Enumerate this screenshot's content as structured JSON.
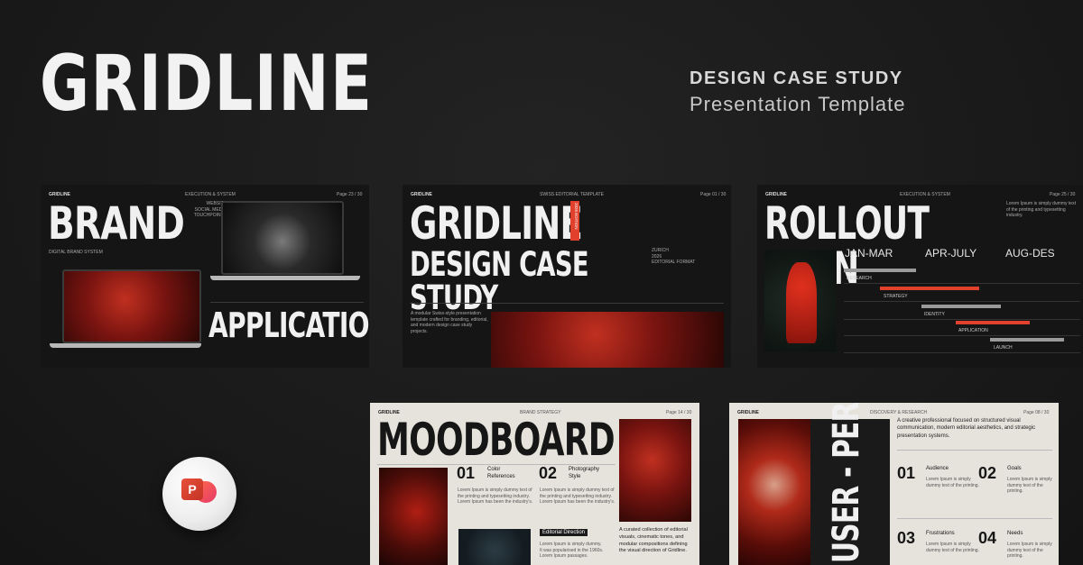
{
  "header": {
    "title": "GRIDLINE",
    "tagline_line1": "DESIGN CASE STUDY",
    "tagline_line2": "Presentation Template"
  },
  "slide1": {
    "logo": "GRIDLINE",
    "section": "EXECUTION & SYSTEM",
    "page": "Page 23 / 30",
    "title": "BRAND",
    "subtitle": "DIGITAL BRAND SYSTEM",
    "menu": [
      "WEBSITE",
      "SOCIAL MEDIA",
      "TOUCHPOINTS"
    ],
    "bottom_title": "APPLICATION"
  },
  "slide2": {
    "logo": "GRIDLINE",
    "section": "SWISS EDITORIAL TEMPLATE",
    "page": "Page 01 / 30",
    "title": "GRIDLINE",
    "edition": "2026 EDITION",
    "subtitle": "DESIGN CASE STUDY",
    "meta": [
      "ZURICH",
      "2026",
      "EDITORIAL FORMAT"
    ],
    "description": "A modular Swiss-style presentation template crafted for branding, editorial, and modern design case study projects."
  },
  "slide3": {
    "logo": "GRIDLINE",
    "section": "EXECUTION & SYSTEM",
    "page": "Page 25 / 30",
    "title": "ROLLOUT PLAN",
    "note": "Lorem Ipsum is simply dummy text of the printing and typesetting industry.",
    "periods": [
      "JAN-MAR",
      "APR-JULY",
      "AUG-DES"
    ],
    "tasks": [
      "RESEARCH",
      "STRATEGY",
      "IDENTITY",
      "APPLICATION",
      "LAUNCH"
    ],
    "colors": {
      "accent": "#e0402c",
      "gray": "#9a9a9a"
    }
  },
  "slide4": {
    "logo": "GRIDLINE",
    "section": "BRAND STRATEGY",
    "page": "Page 14 / 30",
    "title": "MOODBOARD",
    "item1_num": "01",
    "item1_label": "Color References",
    "item2_num": "02",
    "item2_label": "Photography Style",
    "lorem": "Lorem Ipsum is simply dummy text of the printing and typesetting industry. Lorem Ipsum has been the industry's.",
    "editorial_label": "Editorial Direction",
    "bullets": [
      "Lorem Ipsum is simply dummy.",
      "It was popularised in the 1960s.",
      "Lorem Ipsum passages."
    ],
    "caption": "A curated collection of editorial visuals, cinematic tones, and modular compositions defining the visual direction of Gridline."
  },
  "slide5": {
    "logo": "GRIDLINE",
    "section": "DISCOVERY & RESEARCH",
    "page": "Page 08 / 30",
    "intro": "A creative professional focused on structured visual communication, modern editorial aesthetics, and strategic presentation systems.",
    "vertical": "USER - PERSONA",
    "items": [
      {
        "num": "01",
        "label": "Audience"
      },
      {
        "num": "02",
        "label": "Goals"
      },
      {
        "num": "03",
        "label": "Frustrations"
      },
      {
        "num": "04",
        "label": "Needs"
      }
    ],
    "lorem": "Lorem Ipsum is simply dummy text of the printing."
  }
}
